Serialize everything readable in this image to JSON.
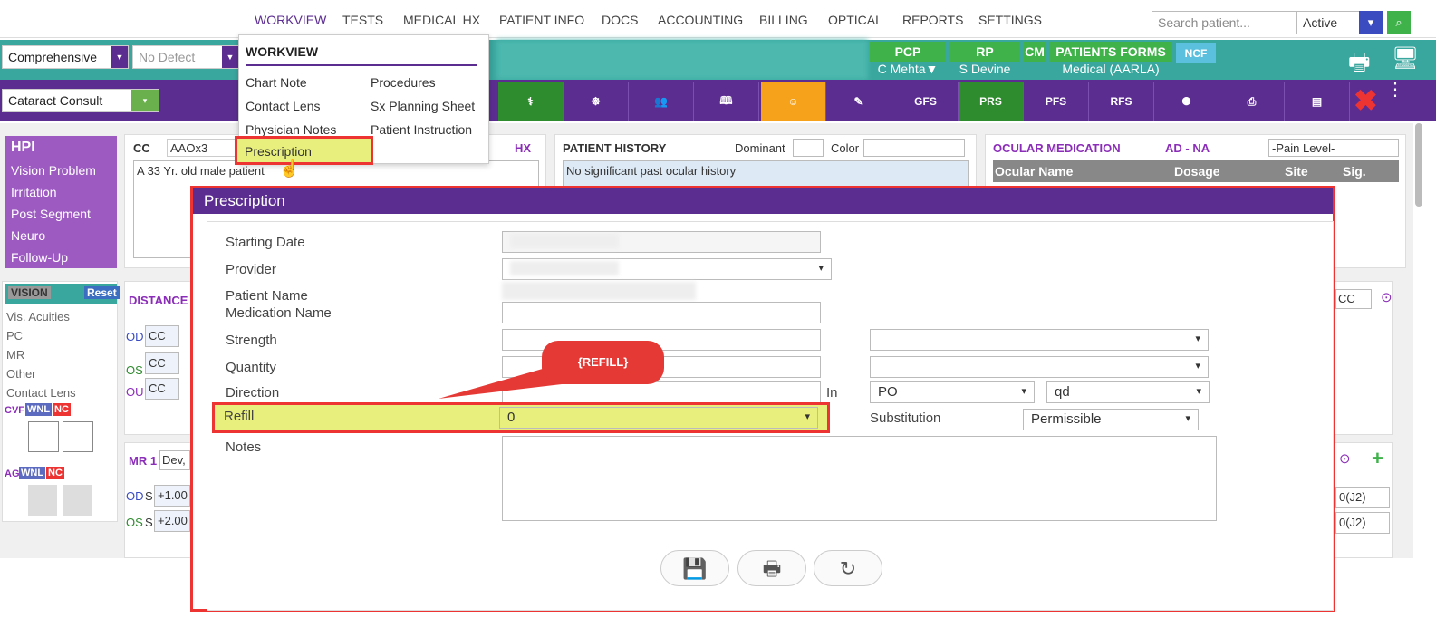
{
  "nav": {
    "items": [
      "WORKVIEW",
      "TESTS",
      "MEDICAL HX",
      "PATIENT INFO",
      "DOCS",
      "ACCOUNTING",
      "BILLING",
      "OPTICAL",
      "REPORTS",
      "SETTINGS"
    ],
    "search_placeholder": "Search patient...",
    "status": "Active"
  },
  "bar2": {
    "exam_type": "Comprehensive",
    "defect": "No Defect",
    "pcp_label": "PCP",
    "pcp_value": "C Mehta▼",
    "rp_label": "RP",
    "rp_value": "S Devine",
    "cm_label": "CM",
    "forms_label": "PATIENTS FORMS",
    "forms_value": "Medical (AARLA)",
    "ncf_label": "NCF"
  },
  "bar3": {
    "visit": "Cataract Consult",
    "icon_labels": [
      "GFS",
      "PRS",
      "PFS",
      "RFS"
    ]
  },
  "menu": {
    "header": "WORKVIEW",
    "col1": [
      "Chart Note",
      "Contact Lens",
      "Physician Notes",
      "Prescription"
    ],
    "col2": [
      "Procedures",
      "Sx Planning Sheet",
      "Patient Instruction"
    ]
  },
  "hpi": {
    "title": "HPI",
    "items": [
      "Vision Problem",
      "Irritation",
      "Post Segment",
      "Neuro",
      "Follow-Up"
    ]
  },
  "cc": {
    "label": "CC",
    "value": "AAOx3",
    "hx": "HX",
    "text": "A 33 Yr. old male patient"
  },
  "history": {
    "title": "PATIENT HISTORY",
    "dominant": "Dominant",
    "color": "Color",
    "text": "No significant past ocular history"
  },
  "ocular": {
    "title": "OCULAR MEDICATION",
    "ad": "AD - NA",
    "pain": "-Pain Level-",
    "cols": [
      "Ocular Name",
      "Dosage",
      "Site",
      "Sig."
    ]
  },
  "vision": {
    "title": "VISION",
    "reset": "Reset",
    "items": [
      "Vis. Acuities",
      "PC",
      "MR",
      "Other",
      "Contact Lens"
    ],
    "cvf": "CVF",
    "ag": "AG",
    "wnl": "WNL",
    "nc": "NC"
  },
  "distance": {
    "label": "DISTANCE",
    "rows": [
      {
        "eye": "OD",
        "val": "CC"
      },
      {
        "eye": "OS",
        "val": "CC"
      },
      {
        "eye": "OU",
        "val": "CC"
      }
    ],
    "right_cc": "CC"
  },
  "mr": {
    "label": "MR 1",
    "value": "Dev,",
    "rows": [
      {
        "eye": "OD",
        "s": "S",
        "val": "+1.00",
        "right": "0(J2)"
      },
      {
        "eye": "OS",
        "s": "S",
        "val": "+2.00",
        "right": "0(J2)"
      }
    ]
  },
  "prescription": {
    "title": "Prescription",
    "labels": [
      "Starting Date",
      "Provider",
      "Patient Name",
      "Medication Name",
      "Strength",
      "Quantity",
      "Direction",
      "Refill",
      "Notes"
    ],
    "in_label": "In",
    "route": "PO",
    "freq": "qd",
    "refill": "0",
    "substitution_label": "Substitution",
    "substitution": "Permissible"
  },
  "callout": "{REFILL}"
}
